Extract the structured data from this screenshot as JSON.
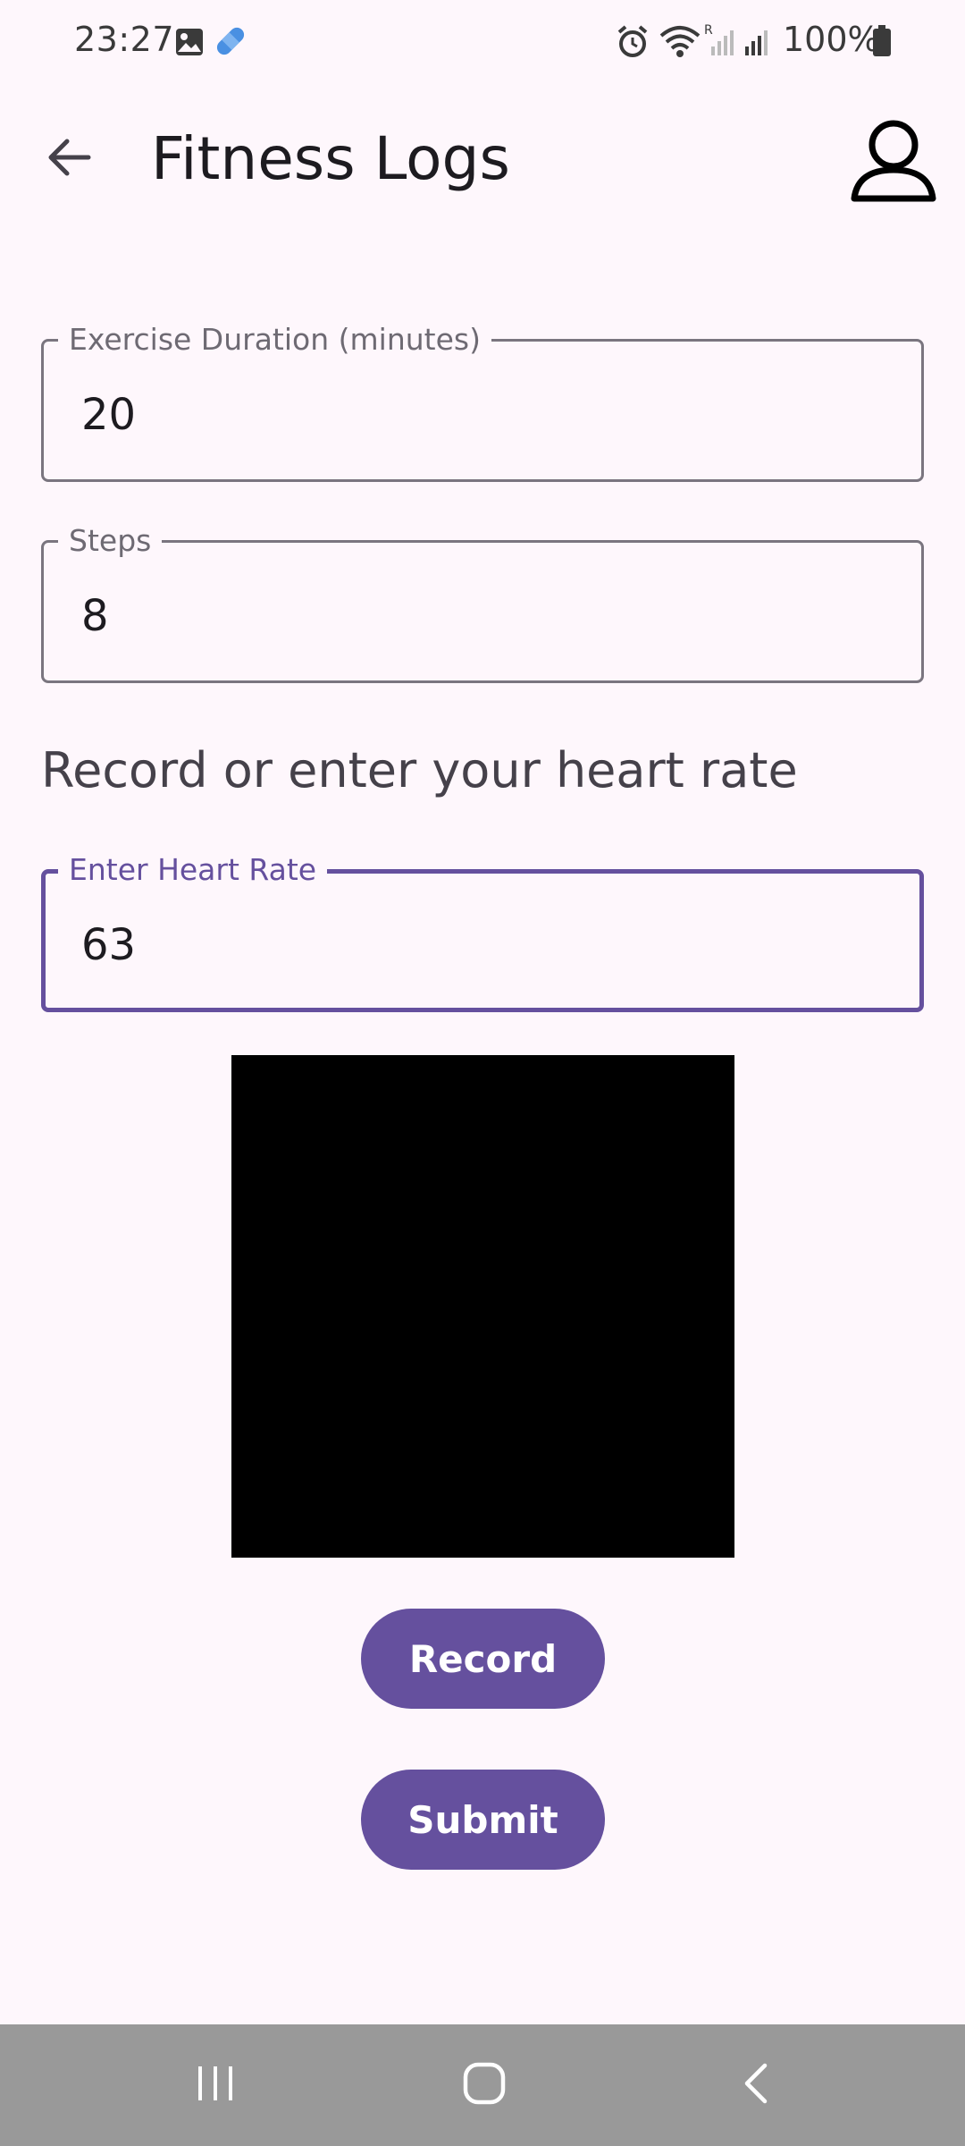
{
  "status_bar": {
    "time": "23:27",
    "battery": "100%",
    "left_icons": [
      "gallery-icon",
      "bandage-icon"
    ],
    "right_icons": [
      "alarm-icon",
      "wifi-icon",
      "roaming-signal-icon",
      "signal-icon",
      "battery-icon"
    ]
  },
  "app_bar": {
    "title": "Fitness Logs",
    "back_icon": "arrow-back-icon",
    "profile_icon": "person-icon"
  },
  "form": {
    "duration": {
      "label": "Exercise Duration (minutes)",
      "value": "20"
    },
    "steps": {
      "label": "Steps",
      "value": "8"
    },
    "heart_rate_prompt": "Record or enter your heart rate",
    "heart_rate": {
      "label": "Enter Heart Rate",
      "value": "63"
    }
  },
  "actions": {
    "record_label": "Record",
    "submit_label": "Submit"
  },
  "nav_bar": {
    "icons": [
      "recent-apps-icon",
      "home-icon",
      "back-icon"
    ]
  },
  "colors": {
    "primary": "#65509e",
    "background": "#fef7fc",
    "outline": "#7a757f",
    "nav_bar": "#999999"
  }
}
